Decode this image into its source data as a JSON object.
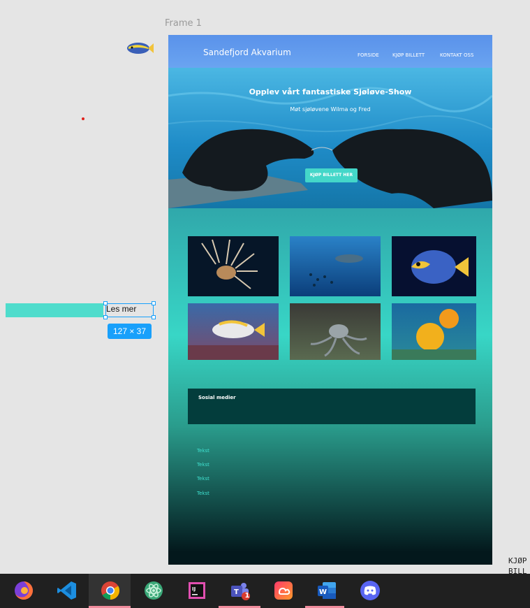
{
  "canvas": {
    "frame_label": "Frame 1",
    "selection": {
      "text": "Les mer",
      "size_label": "127 × 37"
    },
    "stray_text": [
      "KJØP",
      "BILL"
    ]
  },
  "site": {
    "logo": "Sandefjord Akvarium",
    "nav": [
      "FORSIDE",
      "KJØP BILLETT",
      "KONTAKT OSS"
    ],
    "hero": {
      "title": "Opplev vårt fantastiske Sjøløve-Show",
      "subtitle": "Møt sjøløvene Wilma og Fred",
      "button": "KJØP BILLETT HER"
    },
    "gallery": [
      "lionfish",
      "whale-shark",
      "angelfish",
      "surgeonfish",
      "octopus",
      "yellow-fish"
    ],
    "social_title": "Sosial medier",
    "footer_links": [
      "Tekst",
      "Tekst",
      "Tekst",
      "Tekst"
    ]
  },
  "taskbar": {
    "apps": [
      {
        "name": "firefox-icon",
        "active": false,
        "open": false
      },
      {
        "name": "vscode-icon",
        "active": false,
        "open": false
      },
      {
        "name": "chrome-icon",
        "active": true,
        "open": true
      },
      {
        "name": "atom-icon",
        "active": false,
        "open": false
      },
      {
        "name": "intellij-icon",
        "active": false,
        "open": false
      },
      {
        "name": "teams-icon",
        "active": false,
        "open": true,
        "badge": "1"
      },
      {
        "name": "creative-cloud-icon",
        "active": false,
        "open": false
      },
      {
        "name": "word-icon",
        "active": false,
        "open": true
      },
      {
        "name": "discord-icon",
        "active": false,
        "open": false
      }
    ]
  }
}
